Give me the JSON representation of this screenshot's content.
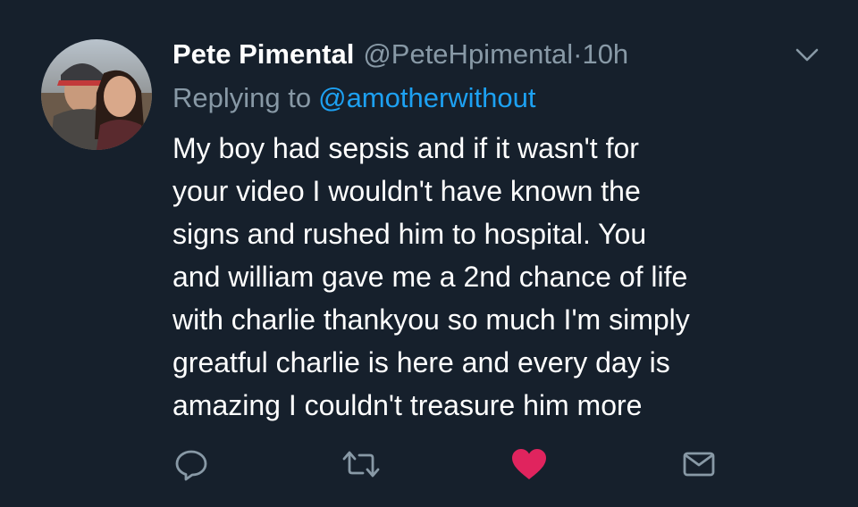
{
  "tweet": {
    "display_name": "Pete Pimental",
    "handle": "@PeteHpimental",
    "separator": "·",
    "time": "10h",
    "replying_prefix": "Replying to",
    "replying_to": "@amotherwithout",
    "body_lines": [
      "My boy had sepsis and if it wasn't for",
      "your video I wouldn't have known the",
      "signs and rushed him to hospital. You",
      "and william gave me a 2nd chance of life",
      "with charlie thankyou so much I'm simply",
      "greatful charlie is here and every day is",
      "amazing I couldn't treasure him more"
    ],
    "liked": true
  },
  "icons": {
    "avatar": "profile-photo",
    "menu": "chevron-down-icon",
    "reply": "reply-bubble-icon",
    "retweet": "retweet-icon",
    "like": "heart-icon",
    "message": "envelope-icon"
  },
  "colors": {
    "background": "#16202c",
    "text_primary": "#ffffff",
    "text_secondary": "#8899a6",
    "link": "#1da1f2",
    "like_active": "#e0245e"
  }
}
